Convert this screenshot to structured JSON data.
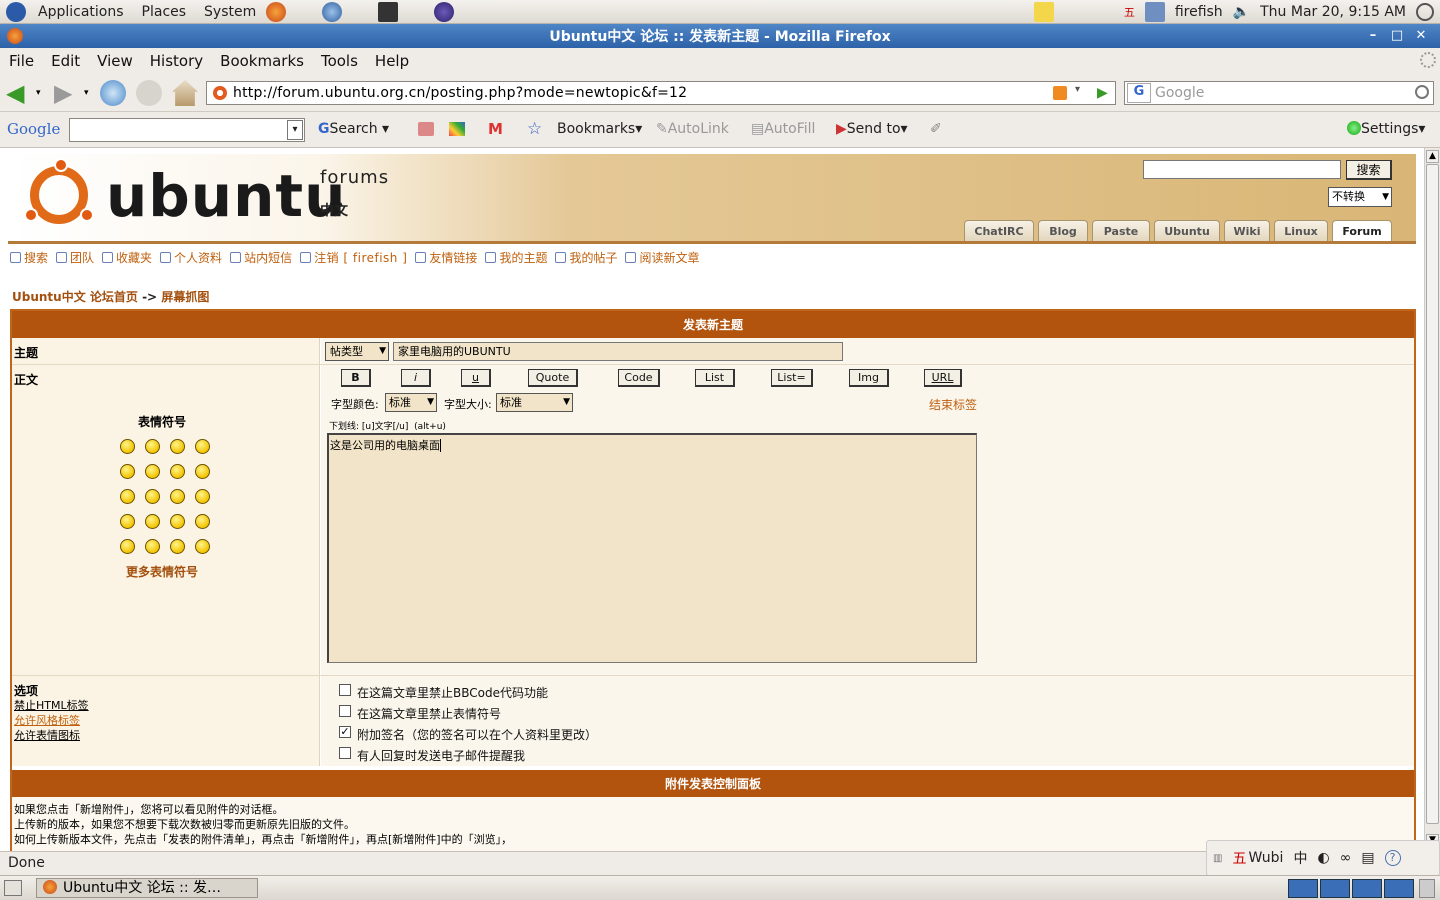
{
  "panel": {
    "menus": [
      "Applications",
      "Places",
      "System"
    ],
    "user": "firefish",
    "datetime": "Thu Mar 20,  9:15 AM"
  },
  "window": {
    "title": "Ubuntu中文 论坛 :: 发表新主题 - Mozilla Firefox"
  },
  "menubar": [
    "File",
    "Edit",
    "View",
    "History",
    "Bookmarks",
    "Tools",
    "Help"
  ],
  "navbar": {
    "url": "http://forum.ubuntu.org.cn/posting.php?mode=newtopic&f=12",
    "search_placeholder": "Google"
  },
  "googlebar": {
    "logo": "Google",
    "search_label": "Search",
    "bookmarks_label": "Bookmarks",
    "autolink": "AutoLink",
    "autofill": "AutoFill",
    "sendto": "Send to",
    "settings": "Settings"
  },
  "header": {
    "logo_text": "ubuntu",
    "forums_label": "forums",
    "chinese_label": "中文",
    "search_button": "搜索",
    "convert_select": "不转换",
    "tabs": [
      "ChatIRC",
      "Blog",
      "Paste",
      "Ubuntu",
      "Wiki",
      "Linux",
      "Forum"
    ]
  },
  "navlinks": [
    "搜索",
    "团队",
    "收藏夹",
    "个人资料",
    "站内短信",
    "注销 [ firefish ]",
    "友情链接",
    "我的主题",
    "我的帖子",
    "阅读新文章"
  ],
  "breadcrumb": {
    "home": "Ubuntu中文 论坛首页",
    "sep": "->",
    "current": "屏幕抓图"
  },
  "form": {
    "header": "发表新主题",
    "subject_label": "主题",
    "post_type": "帖类型",
    "subject_value": "家里电脑用的UBUNTU",
    "body_label": "正文",
    "emoticons_label": "表情符号",
    "more_emoticons": "更多表情符号",
    "bbcode_buttons": [
      "B",
      "i",
      "u",
      "Quote",
      "Code",
      "List",
      "List=",
      "Img",
      "URL"
    ],
    "font_color_label": "字型颜色:",
    "font_color_value": "标准",
    "font_size_label": "字型大小:",
    "font_size_value": "标准",
    "close_tags": "结束标签",
    "help_line": "下划线: [u]文字[/u]  (alt+u)",
    "message": "这是公司用的电脑桌面",
    "options_title": "选项",
    "option_info": [
      "禁止HTML标签",
      "允许风格标签",
      "允许表情图标"
    ],
    "checkboxes": [
      {
        "label": "在这篇文章里禁止BBCode代码功能",
        "checked": false
      },
      {
        "label": "在这篇文章里禁止表情符号",
        "checked": false
      },
      {
        "label": "附加签名（您的签名可以在个人资料里更改）",
        "checked": true
      },
      {
        "label": "有人回复时发送电子邮件提醒我",
        "checked": false
      }
    ],
    "attach_header": "附件发表控制面板",
    "attach_text": [
      "如果您点击「新增附件」，您将可以看见附件的对话框。",
      "上传新的版本，如果您不想要下载次数被归零而更新原先旧版的文件。",
      "如何上传新版本文件，先点击「发表的附件清单」，再点击「新增附件」，再点[新增附件]中的「浏览」，"
    ]
  },
  "status": {
    "text": "Done",
    "ime": "Wubi",
    "ime_lang": "中"
  },
  "taskbar": {
    "window_button": "Ubuntu中文 论坛 :: 发…"
  }
}
